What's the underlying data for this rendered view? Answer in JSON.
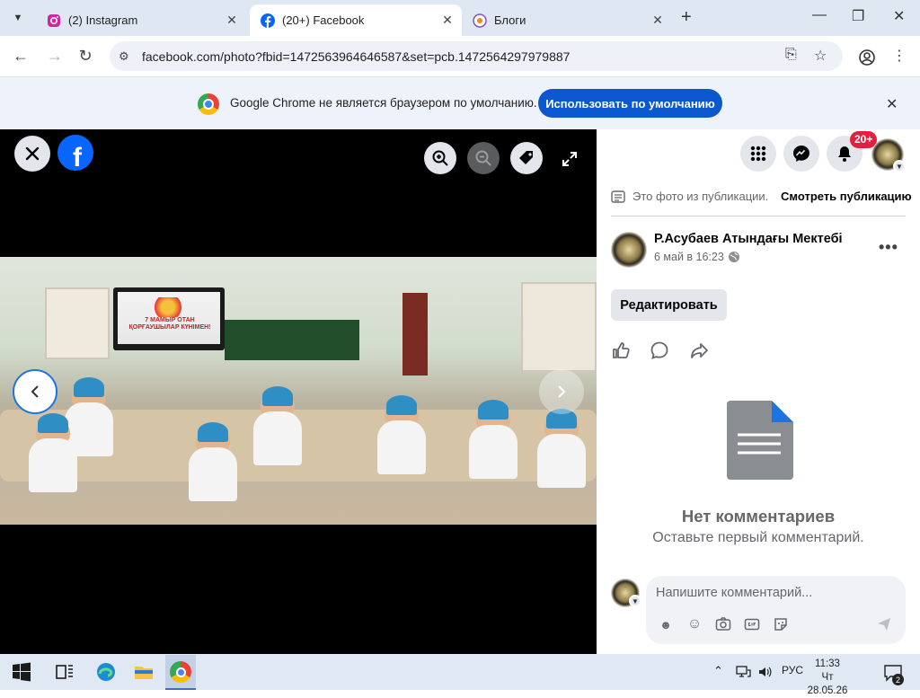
{
  "browser": {
    "tabs": [
      {
        "title": "(2) Instagram",
        "icon": "instagram-icon",
        "active": false
      },
      {
        "title": "(20+) Facebook",
        "icon": "facebook-icon",
        "active": true
      },
      {
        "title": "Блоги",
        "icon": "blog-icon",
        "active": false
      }
    ],
    "new_tab": "+",
    "url": "facebook.com/photo?fbid=1472563964646587&set=pcb.1472564297979887",
    "infobar": {
      "message": "Google Chrome не является браузером по умолчанию.",
      "button_label": "Использовать по умолчанию"
    }
  },
  "viewer": {
    "photo_board_text": "7 МАМЫР ОТАН ҚОРҒАУШЫЛАР КҮНІМЕН!"
  },
  "header": {
    "notification_badge": "20+"
  },
  "post": {
    "from_post_text": "Это фото из публикации.",
    "view_post_link": "Смотреть публикацию",
    "page_name": "Р.Асубаев Атындағы Мектебі",
    "timestamp": "6 май в 16:23",
    "edit_button": "Редактировать",
    "no_comments_title": "Нет комментариев",
    "no_comments_subtitle": "Оставьте первый комментарий.",
    "comment_placeholder": "Напишите комментарий..."
  },
  "taskbar": {
    "language": "РУС",
    "time": "11:33",
    "date": "Чт 28.05.26",
    "notification_count": "2"
  },
  "colors": {
    "facebook_blue": "#0866ff",
    "chrome_button": "#0b57d0",
    "notification_red": "#e41e3f"
  }
}
